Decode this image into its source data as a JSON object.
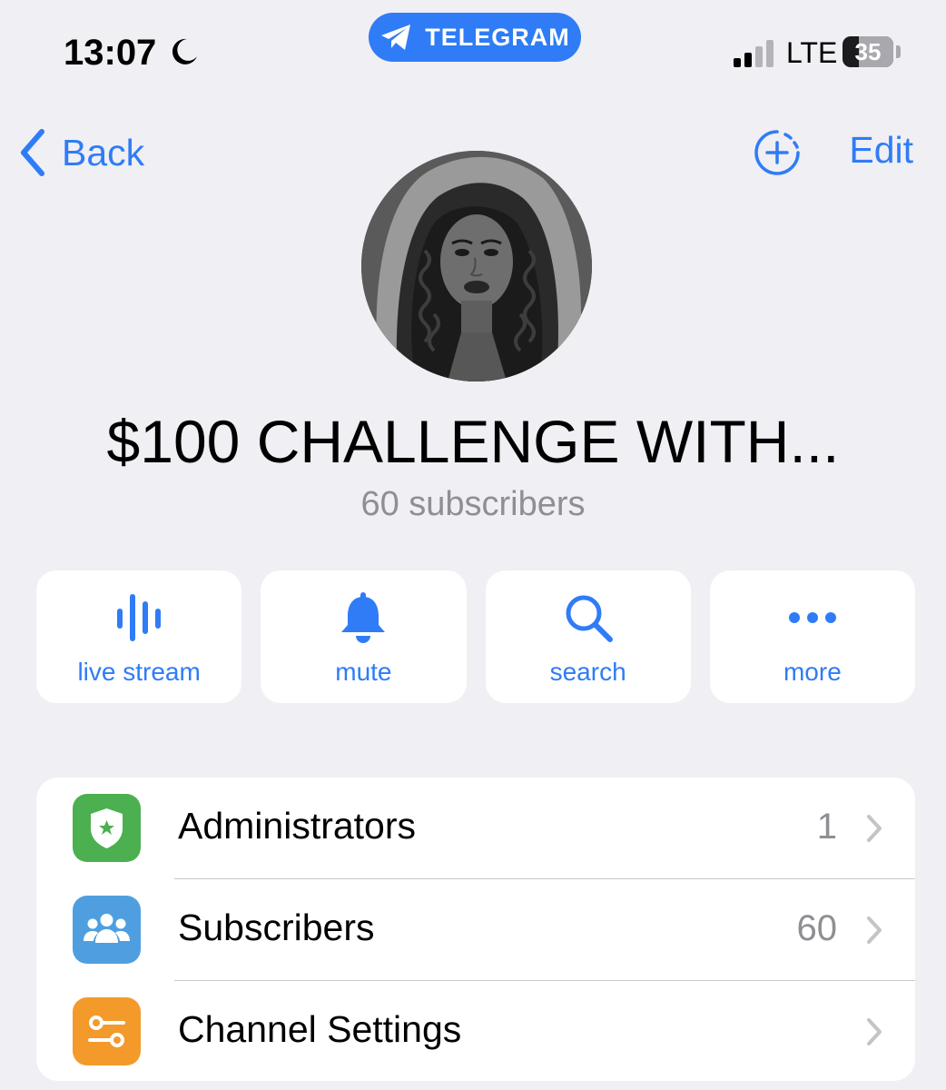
{
  "status_bar": {
    "time": "13:07",
    "app_pill_label": "TELEGRAM",
    "network": "LTE",
    "battery_level": "35"
  },
  "nav": {
    "back_label": "Back",
    "edit_label": "Edit"
  },
  "channel": {
    "name": "$100 CHALLENGE WITH...",
    "subscribers": "60 subscribers"
  },
  "actions": [
    {
      "label": "live stream",
      "icon": "waveform-icon"
    },
    {
      "label": "mute",
      "icon": "bell-icon"
    },
    {
      "label": "search",
      "icon": "magnifier-icon"
    },
    {
      "label": "more",
      "icon": "ellipsis-icon"
    }
  ],
  "settings": [
    {
      "label": "Administrators",
      "value": "1",
      "icon": "shield-icon",
      "color": "#4caf50"
    },
    {
      "label": "Subscribers",
      "value": "60",
      "icon": "people-icon",
      "color": "#4f9fe0"
    },
    {
      "label": "Channel Settings",
      "value": "",
      "icon": "sliders-icon",
      "color": "#f39a2b"
    }
  ],
  "colors": {
    "accent": "#2f7cf6",
    "background": "#efeff4",
    "secondary_text": "#8e8e93"
  }
}
